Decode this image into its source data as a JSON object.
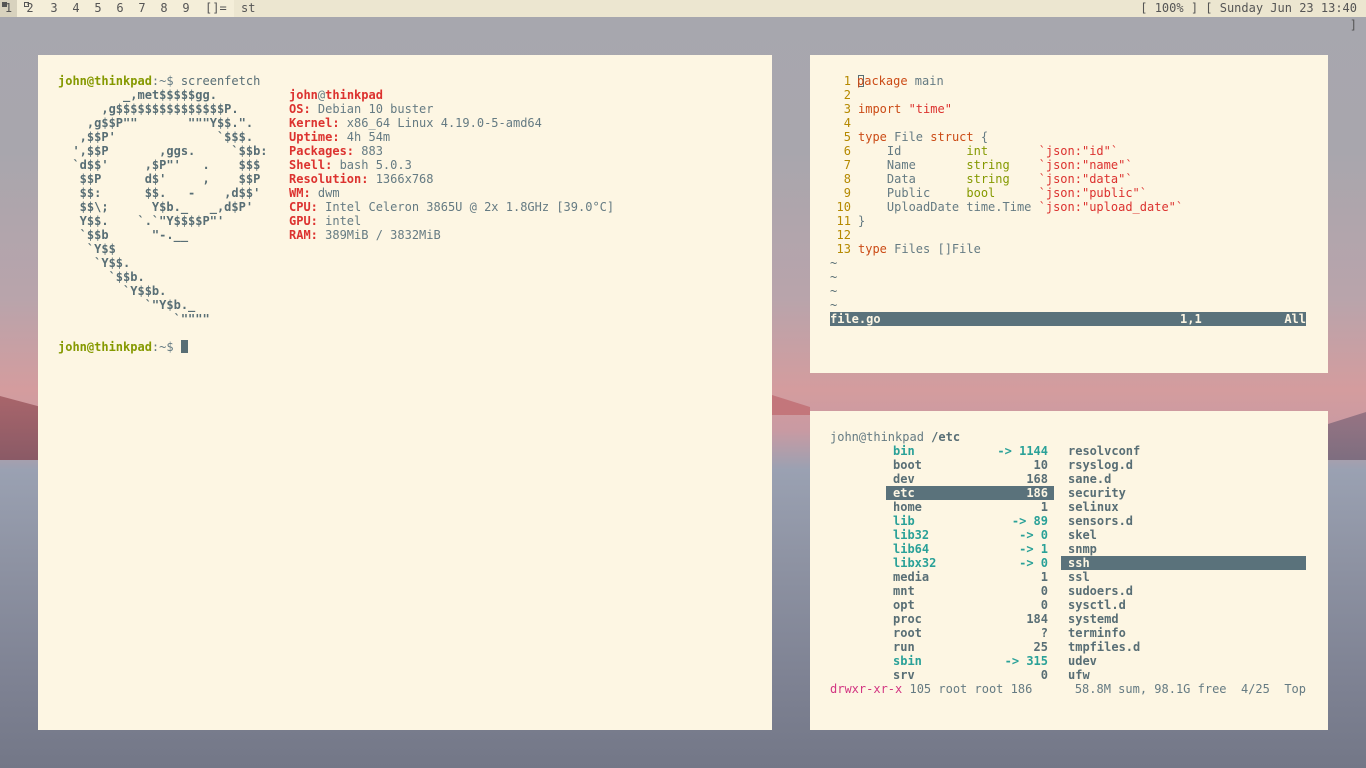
{
  "bar": {
    "tags": [
      "1",
      "2",
      "3",
      "4",
      "5",
      "6",
      "7",
      "8",
      "9"
    ],
    "layout": "[]=",
    "window_title": "st",
    "status": "[ 100% ] [ Sunday Jun 23 13:40 ]"
  },
  "terminal": {
    "prompt_user": "john@thinkpad",
    "prompt_path": ":~$",
    "command": " screenfetch",
    "logo": [
      "         _,met$$$$$gg.",
      "      ,g$$$$$$$$$$$$$$$P.",
      "    ,g$$P\"\"       \"\"\"Y$$.\".",
      "   ,$$P'              `$$$.",
      "  ',$$P       ,ggs.     `$$b:",
      "  `d$$'     ,$P\"'   .    $$$",
      "   $$P      d$'     ,    $$P",
      "   $$:      $$.   -    ,d$$'",
      "   $$\\;      Y$b._   _,d$P'",
      "   Y$$.    `.`\"Y$$$$P\"'",
      "   `$$b      \"-.__",
      "    `Y$$",
      "     `Y$$.",
      "       `$$b.",
      "         `Y$$b.",
      "            `\"Y$b._",
      "                `\"\"\"\""
    ],
    "info_user": "john",
    "info_at": "@",
    "info_host": "thinkpad",
    "info": [
      {
        "key": "OS:",
        "value": " Debian 10 buster"
      },
      {
        "key": "Kernel:",
        "value": " x86_64 Linux 4.19.0-5-amd64"
      },
      {
        "key": "Uptime:",
        "value": " 4h 54m"
      },
      {
        "key": "Packages:",
        "value": " 883"
      },
      {
        "key": "Shell:",
        "value": " bash 5.0.3"
      },
      {
        "key": "Resolution:",
        "value": " 1366x768"
      },
      {
        "key": "WM:",
        "value": " dwm"
      },
      {
        "key": "CPU:",
        "value": " Intel Celeron 3865U @ 2x 1.8GHz [39.0°C]"
      },
      {
        "key": "GPU:",
        "value": " intel"
      },
      {
        "key": "RAM:",
        "value": " 389MiB / 3832MiB"
      }
    ]
  },
  "vim": {
    "line_numbers": [
      "1",
      "2",
      "3",
      "4",
      "5",
      "6",
      "7",
      "8",
      "9",
      "10",
      "11",
      "12",
      "13"
    ],
    "l1_kw": "package",
    "l1_rest": " main",
    "l3_kw": "import",
    "l3_str": " \"time\"",
    "l5_kw": "type",
    "l5_name": " File ",
    "l5_kw2": "struct",
    "l5_rest": " {",
    "fields": [
      {
        "name": "    Id         ",
        "type": "int       ",
        "tag": "`json:\"id\"`"
      },
      {
        "name": "    Name       ",
        "type": "string    ",
        "tag": "`json:\"name\"`"
      },
      {
        "name": "    Data       ",
        "type": "string    ",
        "tag": "`json:\"data\"`"
      },
      {
        "name": "    Public     ",
        "type": "bool      ",
        "tag": "`json:\"public\"`"
      },
      {
        "name": "    UploadDate ",
        "type": "time.Time ",
        "tag": "`json:\"upload_date\"`"
      }
    ],
    "l11": "}",
    "l13_kw": "type",
    "l13_rest": " Files []File",
    "tilde": "~",
    "status_file": "file.go",
    "status_pos": "1,1",
    "status_all": "All"
  },
  "files": {
    "prompt_user": "john@thinkpad",
    "prompt_dir": " /etc",
    "left": [
      {
        "name": "bin",
        "size": "-> 1144",
        "link": true
      },
      {
        "name": "boot",
        "size": "10"
      },
      {
        "name": "dev",
        "size": "168"
      },
      {
        "name": "etc",
        "size": "186",
        "selected": true
      },
      {
        "name": "home",
        "size": "1"
      },
      {
        "name": "lib",
        "size": "-> 89",
        "link": true
      },
      {
        "name": "lib32",
        "size": "-> 0",
        "link": true
      },
      {
        "name": "lib64",
        "size": "-> 1",
        "link": true
      },
      {
        "name": "libx32",
        "size": "-> 0",
        "link": true
      },
      {
        "name": "media",
        "size": "1"
      },
      {
        "name": "mnt",
        "size": "0"
      },
      {
        "name": "opt",
        "size": "0"
      },
      {
        "name": "proc",
        "size": "184"
      },
      {
        "name": "root",
        "size": "?"
      },
      {
        "name": "run",
        "size": "25"
      },
      {
        "name": "sbin",
        "size": "-> 315",
        "link": true
      },
      {
        "name": "srv",
        "size": "0"
      }
    ],
    "right": [
      "resolvconf",
      "rsyslog.d",
      "sane.d",
      "security",
      "selinux",
      "sensors.d",
      "skel",
      "snmp",
      "ssh",
      "ssl",
      "sudoers.d",
      "sysctl.d",
      "systemd",
      "terminfo",
      "tmpfiles.d",
      "udev",
      "ufw"
    ],
    "right_selected": "ssh",
    "footer_perm": "drwxr-xr-x",
    "footer_info": " 105 root root 186",
    "footer_disk": "58.8M sum, 98.1G free  4/25  Top"
  }
}
